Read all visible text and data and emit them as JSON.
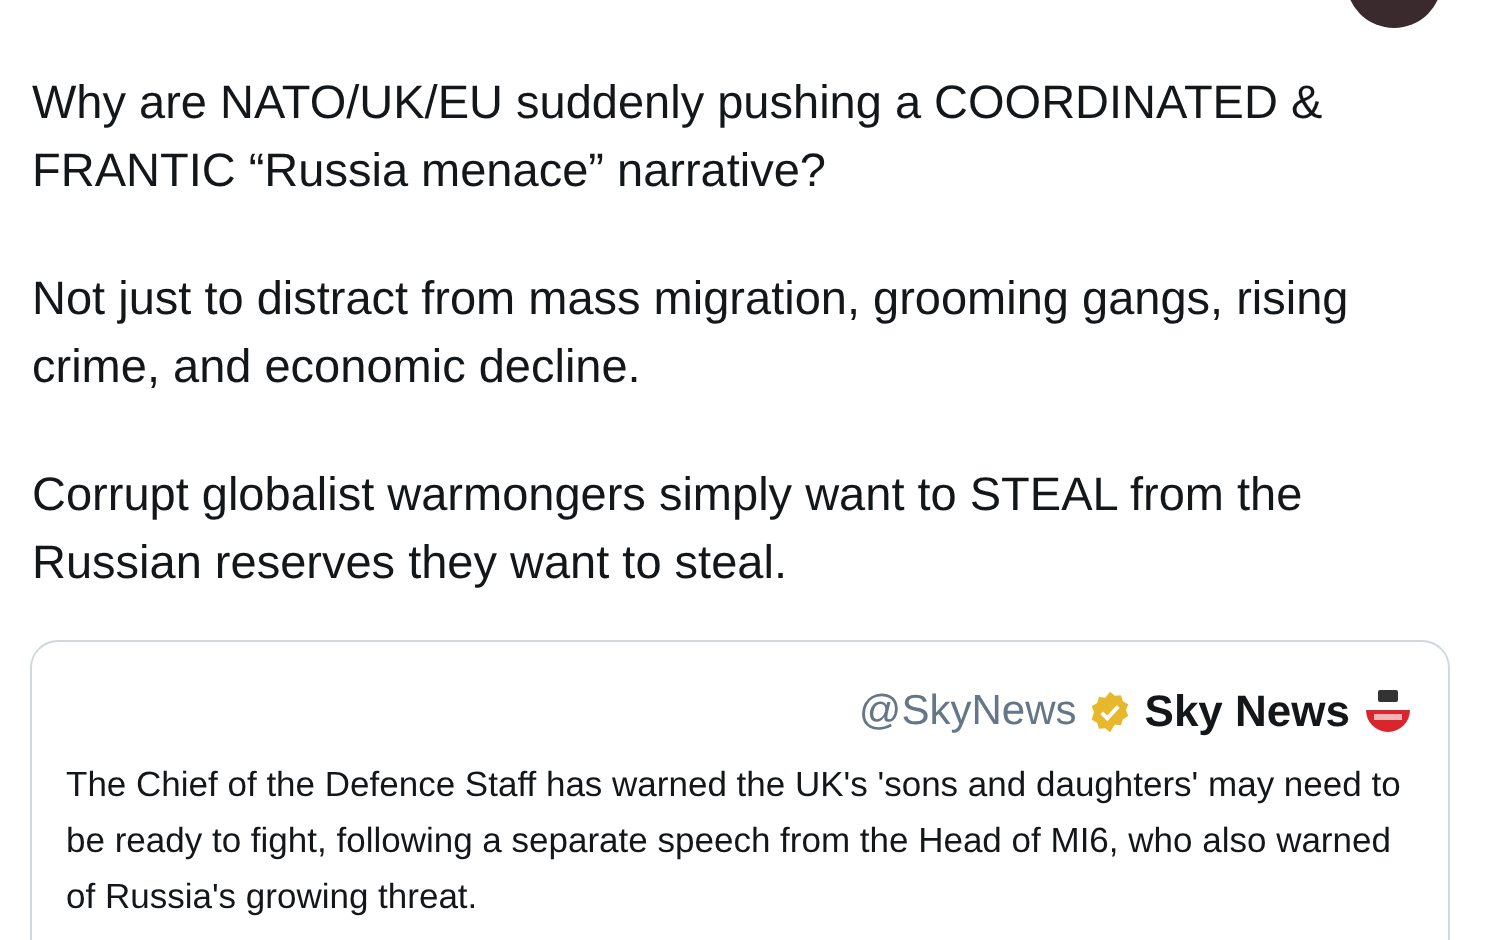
{
  "tweet": {
    "paragraphs": [
      "Why are NATO/UK/EU suddenly pushing a COORDINATED & FRANTIC “Russia menace” narrative?",
      "Not just to distract from mass migration, grooming gangs, rising crime, and economic decline.",
      "Corrupt globalist warmongers simply want to STEAL from the Russian reserves they want to steal."
    ]
  },
  "quoted_tweet": {
    "handle": "@SkyNews",
    "verified": true,
    "name": "Sky News",
    "text": "The Chief of the Defence Staff has warned the UK's 'sons and daughters' may need to be ready to fight, following a separate speech from the Head of MI6, who also warned of Russia's growing threat."
  }
}
